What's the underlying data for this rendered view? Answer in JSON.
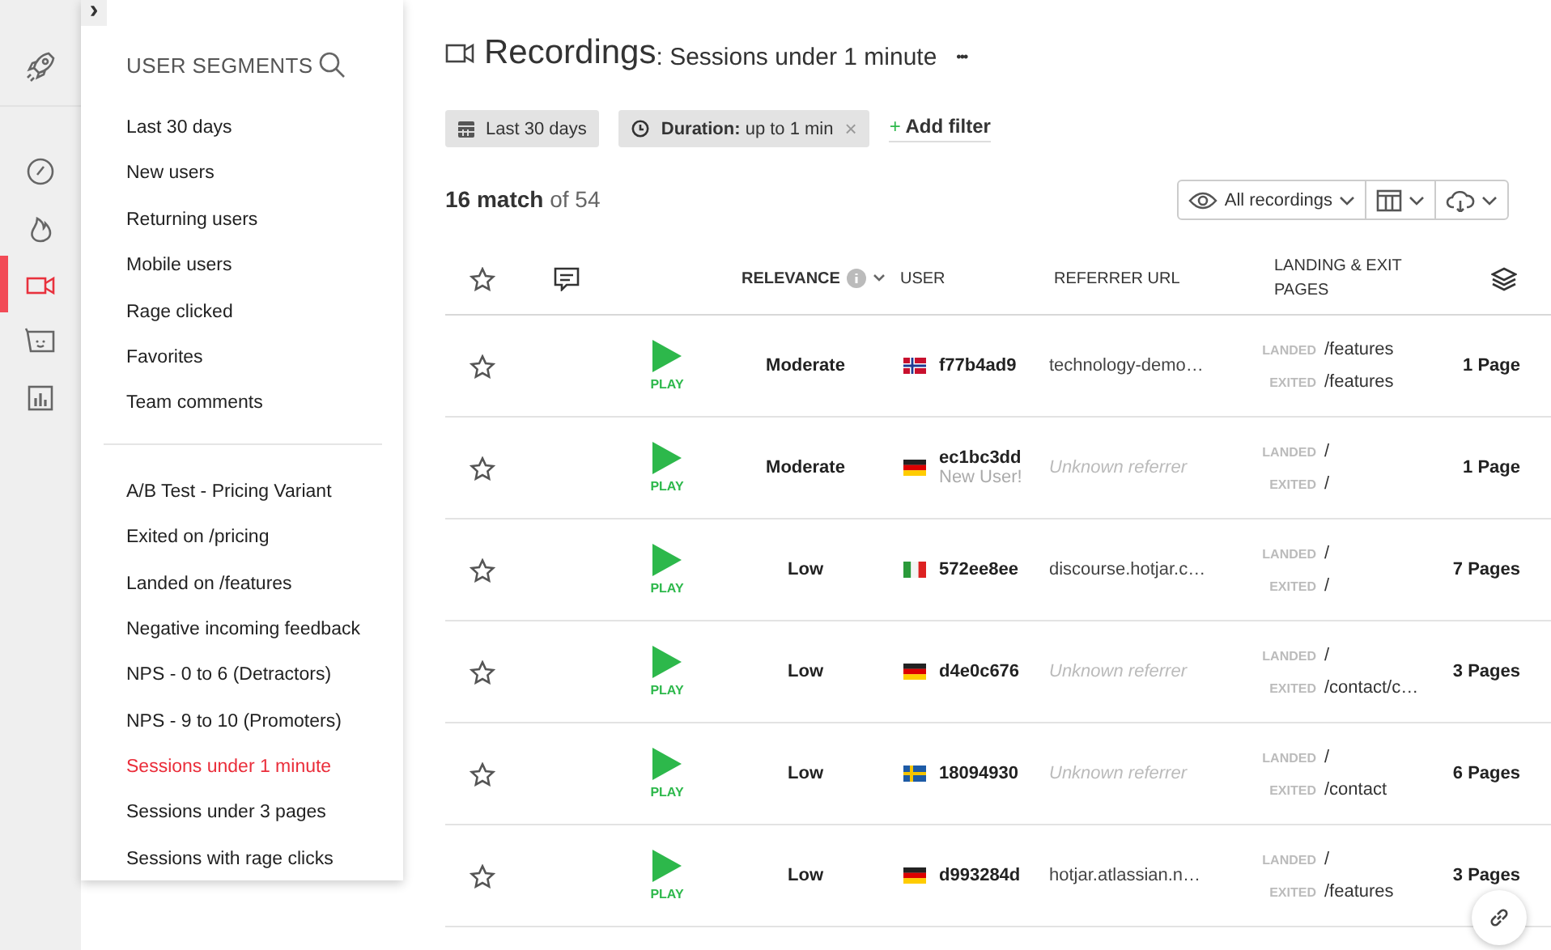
{
  "rail": [
    {
      "kind": "launch",
      "selected": false
    },
    {
      "kind": "dashboard",
      "selected": false
    },
    {
      "kind": "heatmaps",
      "selected": false
    },
    {
      "kind": "recordings",
      "selected": true
    },
    {
      "kind": "feedback",
      "selected": false
    },
    {
      "kind": "reports",
      "selected": false
    }
  ],
  "rail_toggle": "›",
  "segments": {
    "title": "USER SEGMENTS",
    "groups": [
      [
        {
          "label": "Last 30 days",
          "selected": false
        },
        {
          "label": "New users",
          "selected": false
        },
        {
          "label": "Returning users",
          "selected": false
        },
        {
          "label": "Mobile users",
          "selected": false
        },
        {
          "label": "Rage clicked",
          "selected": false
        },
        {
          "label": "Favorites",
          "selected": false
        },
        {
          "label": "Team comments",
          "selected": false
        }
      ],
      [
        {
          "label": "A/B Test - Pricing Variant",
          "selected": false
        },
        {
          "label": "Exited on /pricing",
          "selected": false
        },
        {
          "label": "Landed on /features",
          "selected": false
        },
        {
          "label": "Negative incoming feedback",
          "selected": false
        },
        {
          "label": "NPS - 0 to 6 (Detractors)",
          "selected": false
        },
        {
          "label": "NPS - 9 to 10 (Promoters)",
          "selected": false
        },
        {
          "label": "Sessions under 1 minute",
          "selected": true
        },
        {
          "label": "Sessions under 3 pages",
          "selected": false
        },
        {
          "label": "Sessions with rage clicks",
          "selected": false
        }
      ]
    ]
  },
  "header": {
    "title": "Recordings",
    "subtitle": ": Sessions under 1 minute",
    "more": "•••"
  },
  "filters": [
    {
      "kind": "date",
      "label": "Last 30 days"
    },
    {
      "kind": "duration",
      "name": "Duration:",
      "value": "up to 1 min",
      "remove": "×"
    }
  ],
  "add_filter": {
    "plus": "+",
    "label": "Add filter"
  },
  "match": {
    "count": "16 match",
    "total": " of 54"
  },
  "toolbar": {
    "view": "All recordings"
  },
  "columns": [
    {
      "kind": "star"
    },
    {
      "kind": "comment"
    },
    {
      "kind": "blank"
    },
    {
      "kind": "text",
      "label": "RELEVANCE",
      "info": true
    },
    {
      "kind": "text",
      "label": "USER"
    },
    {
      "kind": "text",
      "label": "REFERRER URL"
    },
    {
      "kind": "text",
      "label": "LANDING & EXIT PAGES"
    },
    {
      "kind": "layers"
    }
  ],
  "rows": [
    {
      "play": "PLAY",
      "relevance": "Moderate",
      "flag": {
        "kind": "no"
      },
      "user": "f77b4ad9",
      "referrer": {
        "kind": "url",
        "text": "technology-demo…"
      },
      "landed_label": "LANDED",
      "landed": "/features",
      "exited_label": "EXITED",
      "exited": "/features",
      "pages": "1 Page"
    },
    {
      "play": "PLAY",
      "relevance": "Moderate",
      "flag": {
        "kind": "de"
      },
      "user": "ec1bc3dd",
      "note": "New User!",
      "referrer": {
        "kind": "unknown",
        "text": "Unknown referrer"
      },
      "landed_label": "LANDED",
      "landed": "/",
      "exited_label": "EXITED",
      "exited": "/",
      "pages": "1 Page"
    },
    {
      "play": "PLAY",
      "relevance": "Low",
      "flag": {
        "kind": "it"
      },
      "user": "572ee8ee",
      "referrer": {
        "kind": "url",
        "text": "discourse.hotjar.c…"
      },
      "landed_label": "LANDED",
      "landed": "/",
      "exited_label": "EXITED",
      "exited": "/",
      "pages": "7 Pages"
    },
    {
      "play": "PLAY",
      "relevance": "Low",
      "flag": {
        "kind": "de"
      },
      "user": "d4e0c676",
      "referrer": {
        "kind": "unknown",
        "text": "Unknown referrer"
      },
      "landed_label": "LANDED",
      "landed": "/",
      "exited_label": "EXITED",
      "exited": "/contact/c…",
      "pages": "3 Pages"
    },
    {
      "play": "PLAY",
      "relevance": "Low",
      "flag": {
        "kind": "se"
      },
      "user": "18094930",
      "referrer": {
        "kind": "unknown",
        "text": "Unknown referrer"
      },
      "landed_label": "LANDED",
      "landed": "/",
      "exited_label": "EXITED",
      "exited": "/contact",
      "pages": "6 Pages"
    },
    {
      "play": "PLAY",
      "relevance": "Low",
      "flag": {
        "kind": "de"
      },
      "user": "d993284d",
      "referrer": {
        "kind": "url",
        "text": "hotjar.atlassian.n…"
      },
      "landed_label": "LANDED",
      "landed": "/",
      "exited_label": "EXITED",
      "exited": "/features",
      "pages": "3 Pages"
    }
  ]
}
